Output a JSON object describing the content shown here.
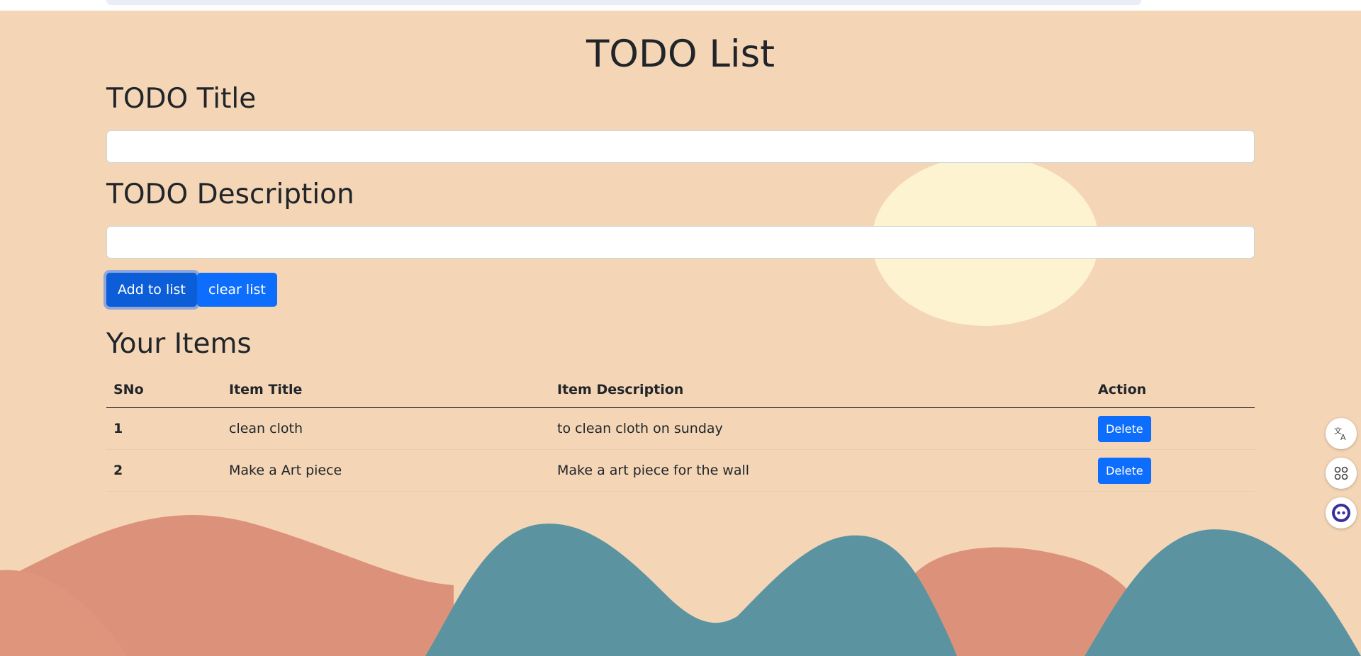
{
  "page": {
    "title": "TODO List",
    "title_label": "TODO Title",
    "description_label": "TODO Description",
    "items_heading": "Your Items"
  },
  "form": {
    "title_value": "",
    "description_value": "",
    "add_label": "Add to list",
    "clear_label": "clear list"
  },
  "table": {
    "headers": [
      "SNo",
      "Item Title",
      "Item Description",
      "Action"
    ],
    "rows": [
      {
        "sno": "1",
        "title": "clean cloth",
        "description": "to clean cloth on sunday",
        "action": "Delete"
      },
      {
        "sno": "2",
        "title": "Make a Art piece",
        "description": "Make a art piece for the wall",
        "action": "Delete"
      }
    ]
  },
  "side_widgets": [
    "translate-icon",
    "apps-grid-icon",
    "assistant-bot-icon"
  ],
  "colors": {
    "background": "#f4d6b7",
    "primary_button": "#0d6efd",
    "hill_teal": "#5b94a0",
    "hill_salmon": "#de957c",
    "sun": "#fdf4d2"
  }
}
